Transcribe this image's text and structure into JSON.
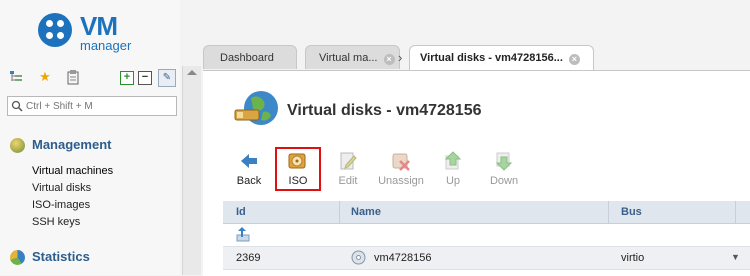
{
  "brand": {
    "logo_main": "VM",
    "logo_sub": "manager"
  },
  "search": {
    "placeholder": "Ctrl + Shift + M"
  },
  "sidebar": {
    "sections": [
      {
        "title": "Management",
        "items": [
          "Virtual machines",
          "Virtual disks",
          "ISO-images",
          "SSH keys"
        ]
      },
      {
        "title": "Statistics"
      }
    ]
  },
  "tabs": [
    {
      "label": "Dashboard"
    },
    {
      "label": "Virtual ma..."
    },
    {
      "label": "Virtual disks - vm4728156..."
    }
  ],
  "page": {
    "title": "Virtual disks - vm4728156"
  },
  "toolbar": [
    {
      "label": "Back"
    },
    {
      "label": "ISO"
    },
    {
      "label": "Edit"
    },
    {
      "label": "Unassign"
    },
    {
      "label": "Up"
    },
    {
      "label": "Down"
    }
  ],
  "table": {
    "columns": [
      "Id",
      "Name",
      "Bus"
    ],
    "rows": [
      {
        "id": "2369",
        "name": "vm4728156",
        "bus": "virtio"
      }
    ]
  },
  "colors": {
    "brand": "#1c72bc",
    "highlight": "#e01010",
    "header_text": "#3a5f8a"
  },
  "icons": [
    "tree-icon",
    "star-icon",
    "clipboard-icon",
    "expand-icon",
    "collapse-icon",
    "pin-icon",
    "search-icon",
    "management-icon",
    "statistics-icon",
    "globe-disk-icon",
    "back-arrow-icon",
    "iso-disc-icon",
    "edit-icon",
    "unassign-icon",
    "up-arrow-icon",
    "down-arrow-icon",
    "disk-icon"
  ]
}
